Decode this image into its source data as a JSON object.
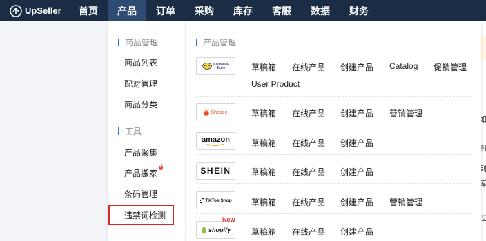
{
  "app": {
    "brand": "UpSeller"
  },
  "nav": [
    "首页",
    "产品",
    "订单",
    "采购",
    "库存",
    "客服",
    "数据",
    "财务"
  ],
  "left": {
    "section1": "商品管理",
    "items1": [
      "商品列表",
      "配对管理",
      "商品分类"
    ],
    "section2": "工具",
    "items2": [
      "产品采集",
      "产品搬家",
      "条码管理",
      "违禁词检测"
    ]
  },
  "right": {
    "title": "产品管理",
    "rows": [
      {
        "logo": "mercado libre",
        "links": [
          "草稿箱",
          "在线产品",
          "创建产品",
          "Catalog",
          "促销管理",
          "User Product"
        ]
      },
      {
        "logo": "Shopee",
        "links": [
          "草稿箱",
          "在线产品",
          "创建产品",
          "营销管理"
        ]
      },
      {
        "logo": "amazon",
        "links": [
          "草稿箱",
          "在线产品",
          "创建产品"
        ]
      },
      {
        "logo": "SHEIN",
        "links": [
          "草稿箱",
          "在线产品",
          "创建产品"
        ]
      },
      {
        "logo": "TikTok Shop",
        "links": [
          "草稿箱",
          "在线产品",
          "创建产品",
          "营销管理"
        ]
      },
      {
        "logo": "shopify",
        "badge": "New",
        "links": [
          "草稿箱",
          "在线产品",
          "创建产品"
        ]
      }
    ]
  },
  "background_text": [
    "如",
    "明",
    "列",
    "库",
    "过"
  ],
  "colors": {
    "topbar": "#1b2c45",
    "active_nav": "#2f4b73",
    "accent": "#2f6fe8",
    "highlight": "#d9262c"
  }
}
